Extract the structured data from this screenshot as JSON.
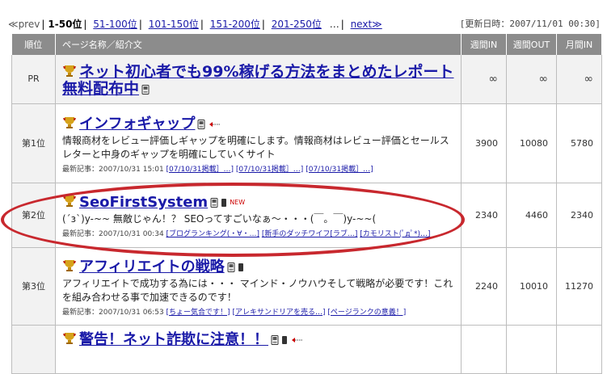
{
  "pager": {
    "prev": "≪prev",
    "current": "1-50位",
    "links": [
      "51-100位",
      "101-150位",
      "151-200位",
      "201-250位"
    ],
    "dots": "…",
    "next": "next≫"
  },
  "updated": "[更新日時：2007/11/01 00:30]",
  "headers": [
    "順位",
    "ページ名称／紹介文",
    "週間IN",
    "週間OUT",
    "月間IN"
  ],
  "rows": [
    {
      "rank": "PR",
      "title": "ネット初心者でも99%稼げる方法をまとめたレポート無料配布中",
      "icons": [
        "trophy-icon",
        "mobile-icon"
      ],
      "desc": "",
      "weekly_in": "∞",
      "weekly_out": "∞",
      "monthly_in": "∞"
    },
    {
      "rank": "第1位",
      "title": "インフォギャップ",
      "icons": [
        "trophy-icon",
        "mobile-icon",
        "arrow-icon"
      ],
      "desc": "情報商材はレビュー評価とセールスレターと中身のギャップを明確にしていくサイト",
      "desc_full": "情報商材をレビュー評価しギャップを明確にします。情報商材はレビュー評価とセールスレターと中身のギャップを明確にしていくサイト",
      "articles_label": "最新記事：2007/10/31 15:01",
      "articles": [
        "[07/10/31掲載］…]",
        "[07/10/31掲載］…]",
        "[07/10/31掲載］…]"
      ],
      "weekly_in": "3900",
      "weekly_out": "10080",
      "monthly_in": "5780"
    },
    {
      "rank": "第2位",
      "title": "SeoFirstSystem",
      "icons": [
        "trophy-icon",
        "mobile-icon",
        "new-icon"
      ],
      "new_label": "NEW",
      "desc_full": "(´з`)y-~~  無敵じゃん！？ SEOってすごいなぁ～・・・(￣。￣)y-~~(",
      "articles_label": "最新記事：2007/10/31 00:34",
      "articles": [
        "[ブログランキング(・∀・…]",
        "[新手のダッチワイフ[ラブ…]",
        "[カモリスト(ﾟдﾟ*)…]"
      ],
      "weekly_in": "2340",
      "weekly_out": "4460",
      "monthly_in": "2340"
    },
    {
      "rank": "第3位",
      "title": "アフィリエイトの戦略",
      "icons": [
        "trophy-icon",
        "mobile-icon"
      ],
      "desc_full": "アフィリエイトで成功する為には・・・ マインド・ノウハウそして戦略が必要です！これを組み合わせる事で加速できるのです！",
      "articles_label": "最新記事：2007/10/31 06:53",
      "articles": [
        "[ちょー気合です！]",
        "[アレキサンドリアを売る…]",
        "[ページランクの意義！]"
      ],
      "weekly_in": "2240",
      "weekly_out": "10010",
      "monthly_in": "11270"
    },
    {
      "rank": "",
      "title": "警告！ネット詐欺に注意！！",
      "icons": [
        "trophy-icon",
        "mobile-icon",
        "arrow-icon"
      ],
      "weekly_in": "",
      "weekly_out": "",
      "monthly_in": ""
    }
  ]
}
